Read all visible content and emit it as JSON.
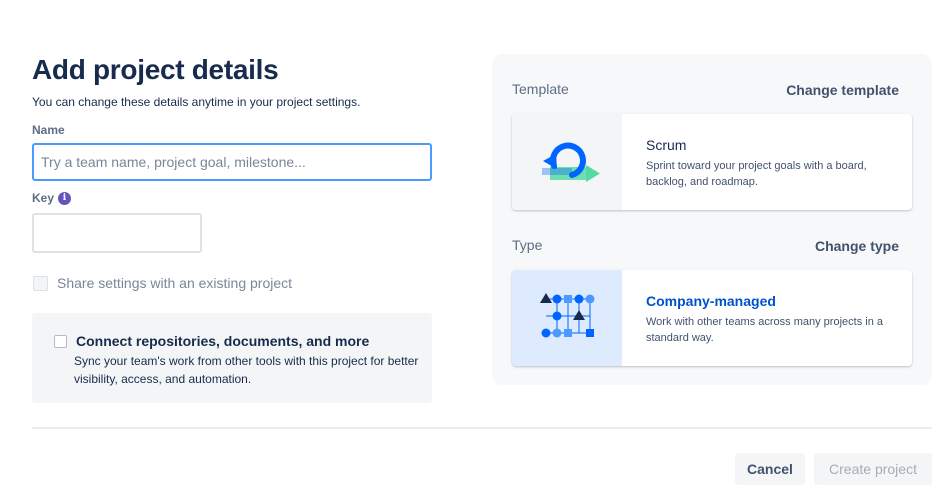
{
  "header": {
    "title": "Add project details",
    "subtitle": "You can change these details anytime in your project settings."
  },
  "form": {
    "name_label": "Name",
    "name_placeholder": "Try a team name, project goal, milestone...",
    "name_value": "",
    "key_label": "Key",
    "key_value": "",
    "share_label": "Share settings with an existing project",
    "share_checked": false,
    "connect_title": "Connect repositories, documents, and more",
    "connect_description": "Sync your team's work from other tools with this project for better visibility, access, and automation.",
    "connect_checked": false
  },
  "side": {
    "template_label": "Template",
    "change_template": "Change template",
    "template_card": {
      "title": "Scrum",
      "description": "Sprint toward your project goals with a board, backlog, and roadmap.",
      "icon": "scrum-cycle-icon"
    },
    "type_label": "Type",
    "change_type": "Change type",
    "type_card": {
      "title": "Company-managed",
      "description": "Work with other teams across many projects in a standard way.",
      "icon": "workflow-diagram-icon"
    }
  },
  "footer": {
    "cancel_label": "Cancel",
    "create_label": "Create project",
    "create_enabled": false
  },
  "colors": {
    "title": "#172b4d",
    "focus_border": "#4c9aff",
    "link_blue": "#0052cc",
    "info_purple": "#6554c0",
    "panel_bg": "#f4f5f7"
  }
}
